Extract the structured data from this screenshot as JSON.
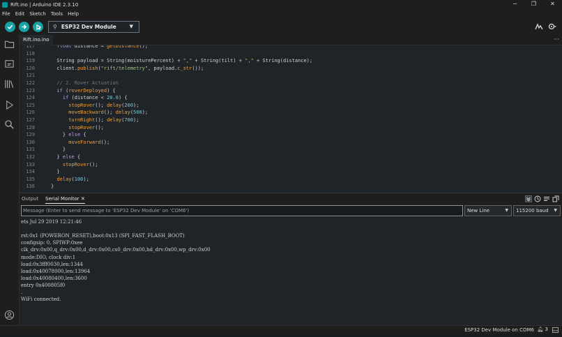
{
  "window": {
    "title": "Rift.ino | Arduino IDE 2.3.10"
  },
  "menu": [
    "File",
    "Edit",
    "Sketch",
    "Tools",
    "Help"
  ],
  "toolbar": {
    "board": "ESP32 Dev Module"
  },
  "editor": {
    "tab": "Rift.ino.ino",
    "lines": [
      {
        "n": "117",
        "code": "  float distance = getDistance();"
      },
      {
        "n": "118",
        "code": ""
      },
      {
        "n": "119",
        "code": "  String payload = String(moisturePercent) + \",\" + String(tilt) + \",\" + String(distance);"
      },
      {
        "n": "120",
        "code": "  client.publish(\"rift/telemetry\", payload.c_str());"
      },
      {
        "n": "121",
        "code": ""
      },
      {
        "n": "122",
        "code": "  // 2. Rover Actuation"
      },
      {
        "n": "123",
        "code": "  if (roverDeployed) {"
      },
      {
        "n": "124",
        "code": "    if (distance < 20.0) {"
      },
      {
        "n": "125",
        "code": "      stopRover(); delay(200);"
      },
      {
        "n": "126",
        "code": "      moveBackward(); delay(500);"
      },
      {
        "n": "127",
        "code": "      turnRight(); delay(700);"
      },
      {
        "n": "128",
        "code": "      stopRover();"
      },
      {
        "n": "129",
        "code": "    } else {"
      },
      {
        "n": "130",
        "code": "      moveForward();"
      },
      {
        "n": "131",
        "code": "    }"
      },
      {
        "n": "132",
        "code": "  } else {"
      },
      {
        "n": "133",
        "code": "    stopRover();"
      },
      {
        "n": "134",
        "code": "  }"
      },
      {
        "n": "135",
        "code": "  delay(100);"
      },
      {
        "n": "136",
        "code": "}"
      }
    ]
  },
  "panel": {
    "tabs": [
      "Output",
      "Serial Monitor"
    ],
    "message_placeholder": "Message (Enter to send message to 'ESP32 Dev Module' on 'COM6')",
    "line_ending": "New Line",
    "baud": "115200 baud",
    "output": [
      "ets Jul 29 2019 12:21:46",
      "",
      "rst:0x1 (POWERON_RESET),boot:0x13 (SPI_FAST_FLASH_BOOT)",
      "configsip: 0, SPIWP:0xee",
      "clk_drv:0x00,q_drv:0x00,d_drv:0x00,cs0_drv:0x00,hd_drv:0x00,wp_drv:0x00",
      "mode:DIO, clock div:1",
      "load:0x3fff0030,len:1344",
      "load:0x40078000,len:13964",
      "load:0x40080400,len:3600",
      "entry 0x400805f0",
      ".",
      "WiFi connected."
    ]
  },
  "status": {
    "board_port": "ESP32 Dev Module on COM6",
    "notifications": "3"
  },
  "colors": {
    "accent": "#17a1a5",
    "bg": "#1f2428",
    "chrome": "#1e1e1e"
  }
}
